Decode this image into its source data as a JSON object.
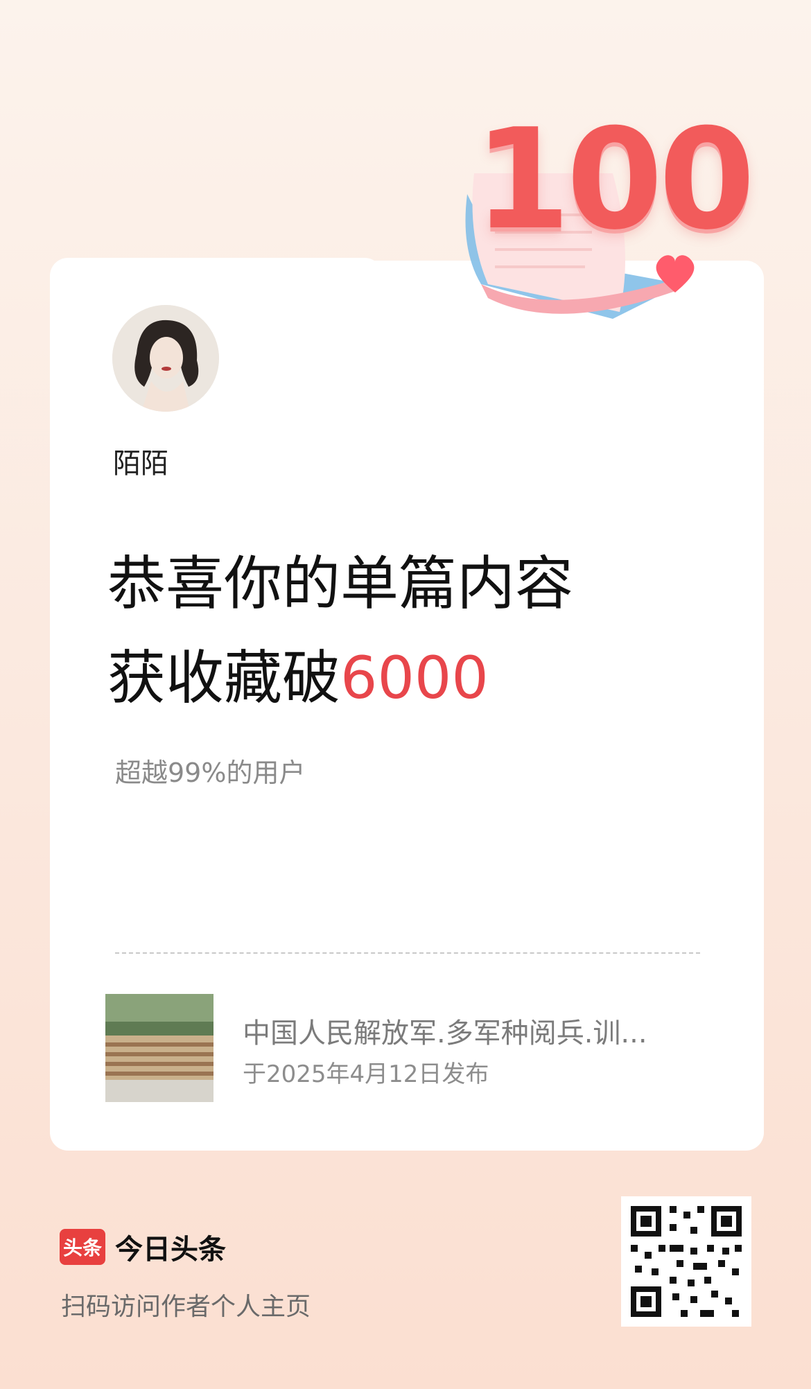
{
  "badge": {
    "number": "100",
    "icon": "heart-icon"
  },
  "user": {
    "name": "陌陌"
  },
  "headline": {
    "line1": "恭喜你的单篇内容",
    "line2_prefix": "获收藏破",
    "line2_highlight": "6000"
  },
  "subtext": "超越99%的用户",
  "article": {
    "title": "中国人民解放军.多军种阅兵.训...",
    "date": "于2025年4月12日发布"
  },
  "footer": {
    "logo_text": "头条",
    "brand_name": "今日头条",
    "scan_text": "扫码访问作者个人主页"
  },
  "colors": {
    "accent": "#e8464b",
    "brand": "#e8403f"
  }
}
